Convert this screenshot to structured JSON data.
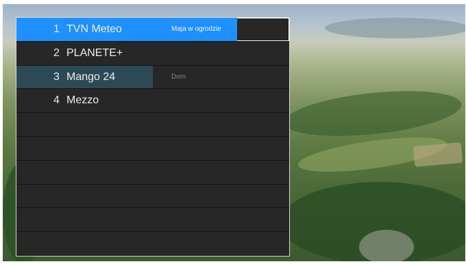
{
  "colors": {
    "selected_highlight": "#1e90ff",
    "focused_highlight": "#2b4a55",
    "panel": "#262626"
  },
  "channels": [
    {
      "number": "1",
      "name": "TVN Meteo",
      "program": "Maja w ogrodzie",
      "progress": 0.81,
      "state": "selected"
    },
    {
      "number": "2",
      "name": "PLANETE+",
      "program": "",
      "progress": 0,
      "state": "normal"
    },
    {
      "number": "3",
      "name": "Mango 24",
      "program": "Dom",
      "progress": 0.5,
      "state": "focused"
    },
    {
      "number": "4",
      "name": "Mezzo",
      "program": "",
      "progress": 0,
      "state": "normal"
    },
    {
      "number": "",
      "name": "",
      "program": "",
      "progress": 0,
      "state": "empty"
    },
    {
      "number": "",
      "name": "",
      "program": "",
      "progress": 0,
      "state": "empty"
    },
    {
      "number": "",
      "name": "",
      "program": "",
      "progress": 0,
      "state": "empty"
    },
    {
      "number": "",
      "name": "",
      "program": "",
      "progress": 0,
      "state": "empty"
    },
    {
      "number": "",
      "name": "",
      "program": "",
      "progress": 0,
      "state": "empty"
    },
    {
      "number": "",
      "name": "",
      "program": "",
      "progress": 0,
      "state": "empty"
    }
  ]
}
